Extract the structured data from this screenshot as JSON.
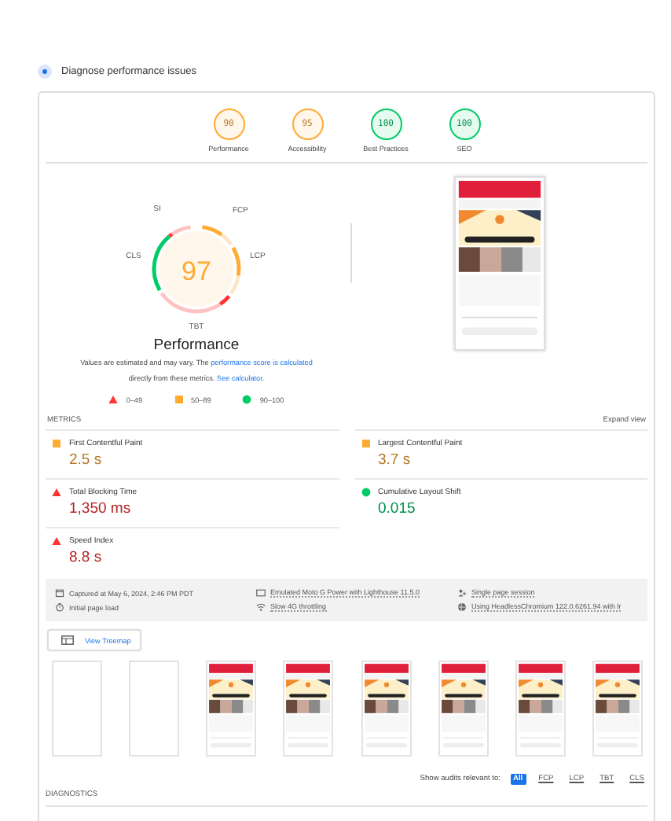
{
  "header": {
    "label": "Diagnose performance issues",
    "selected": true
  },
  "categories": [
    {
      "label": "Performance",
      "score": "90",
      "color": "#ffaa33"
    },
    {
      "label": "Accessibility",
      "score": "95",
      "color": "#ffaa33"
    },
    {
      "label": "Best Practices",
      "score": "100",
      "color": "#00cc66"
    },
    {
      "label": "SEO",
      "score": "100",
      "color": "#00cc66"
    }
  ],
  "performance": {
    "score": "97",
    "title": "Performance",
    "color": "#ffaa33",
    "gauge_labels": [
      {
        "label": "SI",
        "color": "#ff3333"
      },
      {
        "label": "FCP",
        "color": "#ffaa33"
      },
      {
        "label": "LCP",
        "color": "#ffaa33"
      },
      {
        "label": "TBT",
        "color": "#ff3333"
      },
      {
        "label": "CLS",
        "color": "#00cc66"
      }
    ],
    "note": "Values are estimated and may vary. The ",
    "note_link": "performance score is calculated",
    "note_2": "directly from these metrics.",
    "note_link_2": "See calculator.",
    "legend": [
      {
        "label": "0–49",
        "kind": "triangle",
        "color": "#ff3333"
      },
      {
        "label": "50–89",
        "kind": "square",
        "color": "#ffaa33"
      },
      {
        "label": "90–100",
        "kind": "circle",
        "color": "#00cc66"
      }
    ]
  },
  "metrics": {
    "title": "METRICS",
    "action": "Expand view",
    "items": [
      {
        "label": "First Contentful Paint",
        "value": "2.5 s",
        "kind": "square",
        "color": "#ffaa33"
      },
      {
        "label": "Largest Contentful Paint",
        "value": "3.7 s",
        "kind": "square",
        "color": "#ffaa33"
      },
      {
        "label": "Total Blocking Time",
        "value": "1,350 ms",
        "kind": "triangle",
        "color": "#ff3333"
      },
      {
        "label": "Cumulative Layout Shift",
        "value": "0.015",
        "kind": "circle",
        "color": "#00cc66"
      },
      {
        "label": "Speed Index",
        "value": "8.8 s",
        "kind": "triangle",
        "color": "#ff3333"
      }
    ]
  },
  "run_info": [
    {
      "kind": "calendar",
      "text": "Captured at May 6, 2024, 2:46 PM PDT"
    },
    {
      "kind": "device",
      "text": "Emulated Moto G Power with Lighthouse 11.5.0"
    },
    {
      "kind": "person",
      "text": "Single page session"
    },
    {
      "kind": "timer",
      "text": "Initial page load"
    },
    {
      "kind": "wifi",
      "text": "Slow 4G throttling"
    },
    {
      "kind": "globe",
      "text": "Using HeadlessChromium 122.0.6261.94 with lr"
    }
  ],
  "treemap_button": "View Treemap",
  "filmstrip": [
    {
      "kind": "blank"
    },
    {
      "kind": "blank"
    },
    {
      "kind": "picture"
    },
    {
      "kind": "picture"
    },
    {
      "kind": "picture"
    },
    {
      "kind": "picture"
    },
    {
      "kind": "picture"
    },
    {
      "kind": "picture"
    }
  ],
  "audit_filter": {
    "label": "Show audits relevant to:",
    "options": [
      {
        "label": "All",
        "selected": true
      },
      {
        "label": "FCP",
        "selected": false
      },
      {
        "label": "LCP",
        "selected": false
      },
      {
        "label": "TBT",
        "selected": false
      },
      {
        "label": "CLS",
        "selected": false
      }
    ]
  },
  "diagnostics_title": "DIAGNOSTICS"
}
